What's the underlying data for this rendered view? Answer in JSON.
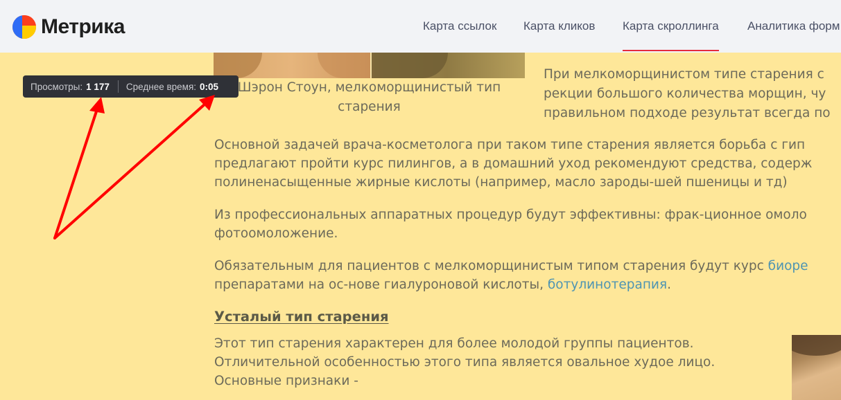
{
  "header": {
    "logo_text": "Метрика",
    "tabs": [
      {
        "label": "Карта ссылок",
        "active": false
      },
      {
        "label": "Карта кликов",
        "active": false
      },
      {
        "label": "Карта скроллинга",
        "active": true
      },
      {
        "label": "Аналитика форм",
        "active": false
      }
    ]
  },
  "tooltip": {
    "views_label": "Просмотры:",
    "views_value": "1 177",
    "time_label": "Среднее время:",
    "time_value": "0:05"
  },
  "article": {
    "caption": "Шэрон Стоун, мелкоморщинистый тип старения",
    "side_text": "При мелкоморщинистом типе старения с\nрекции большого количества морщин, чу\nправильном подходе результат всегда по",
    "p1": "Основной задачей врача-косметолога при таком типе старения является борьба с гип\nпредлагают пройти курс пилингов, а в домашний уход рекомендуют средства, содерж\nполиненасыщенные жирные кислоты (например, масло зароды-шей пшеницы и тд)",
    "p2": "Из профессиональных аппаратных процедур будут эффективны: фрак-ционное омоло\nфотоомоложение.",
    "p3_before": "Обязательным для пациентов с мелкоморщинистым типом старения будут курс ",
    "p3_link1": "биоре",
    "p3_line2_before": "препаратами на ос-нове гиалуроновой кислоты, ",
    "p3_link2": "ботулинотерапия",
    "p3_end": ".",
    "heading": "Усталый тип старения",
    "p5": "Этот тип старения характерен для более молодой группы пациентов.\nОтличительной особенностью этого типа является овальное худое лицо.\nОсновные признаки -"
  },
  "colors": {
    "page_bg": "#fee799",
    "header_bg": "#f2f3f6",
    "active_tab_underline": "#e52a3c",
    "tooltip_bg": "#2f3137",
    "arrow": "#ff0000",
    "link": "#4e94b2"
  }
}
